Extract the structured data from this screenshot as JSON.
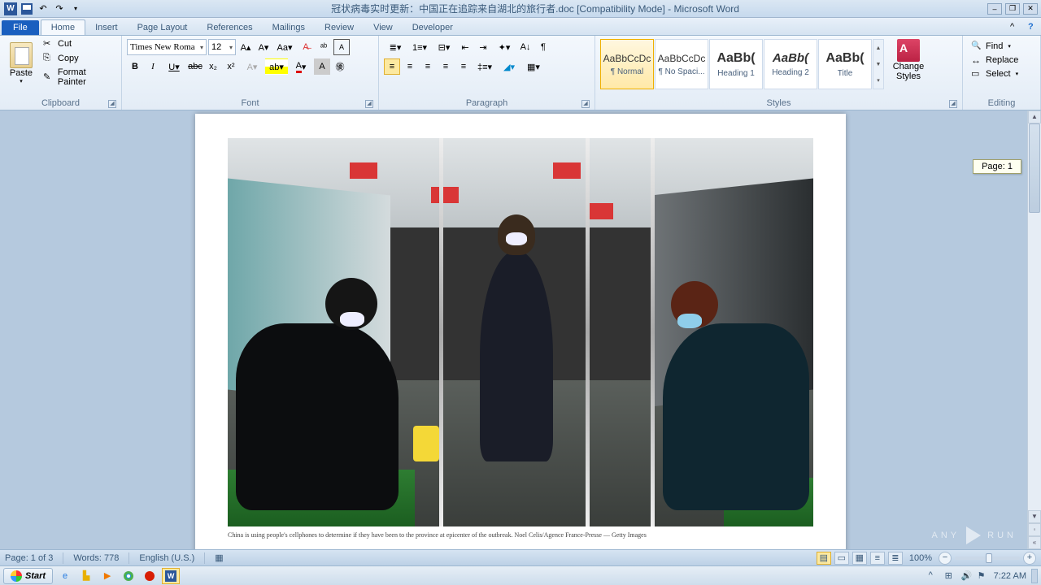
{
  "title": "冠状病毒实时更新：中国正在追踪来自湖北的旅行者.doc [Compatibility Mode]  -  Microsoft Word",
  "tabs": {
    "file": "File",
    "home": "Home",
    "insert": "Insert",
    "page_layout": "Page Layout",
    "references": "References",
    "mailings": "Mailings",
    "review": "Review",
    "view": "View",
    "developer": "Developer"
  },
  "clipboard": {
    "paste": "Paste",
    "cut": "Cut",
    "copy": "Copy",
    "format_painter": "Format Painter",
    "label": "Clipboard"
  },
  "font": {
    "name": "Times New Roma",
    "size": "12",
    "label": "Font"
  },
  "paragraph": {
    "label": "Paragraph"
  },
  "styles": {
    "label": "Styles",
    "change_styles": "Change Styles",
    "items": [
      {
        "preview": "AaBbCcDc",
        "name": "¶ Normal",
        "sel": true,
        "font": "normal",
        "size": "11px",
        "color": "#333"
      },
      {
        "preview": "AaBbCcDc",
        "name": "¶ No Spaci...",
        "sel": false,
        "font": "normal",
        "size": "11px",
        "color": "#333"
      },
      {
        "preview": "AaBb(",
        "name": "Heading 1",
        "sel": false,
        "font": "bold",
        "size": "16px",
        "color": "#000"
      },
      {
        "preview": "AaBb(",
        "name": "Heading 2",
        "sel": false,
        "font": "bold italic",
        "size": "15px",
        "color": "#000"
      },
      {
        "preview": "AaBb(",
        "name": "Title",
        "sel": false,
        "font": "bold",
        "size": "16px",
        "color": "#000"
      }
    ]
  },
  "editing": {
    "find": "Find",
    "replace": "Replace",
    "select": "Select",
    "label": "Editing"
  },
  "page_indicator": "Page: 1",
  "caption": "China is using people's cellphones to determine if they have been to the province at epicenter of the outbreak.   Noel Celis/Agence France-Presse — Getty Images",
  "statusbar": {
    "page": "Page: 1 of 3",
    "words": "Words: 778",
    "lang": "English (U.S.)",
    "zoom": "100%"
  },
  "taskbar": {
    "start": "Start",
    "time": "7:22 AM"
  },
  "watermark": {
    "a": "ANY",
    "b": "RUN"
  }
}
